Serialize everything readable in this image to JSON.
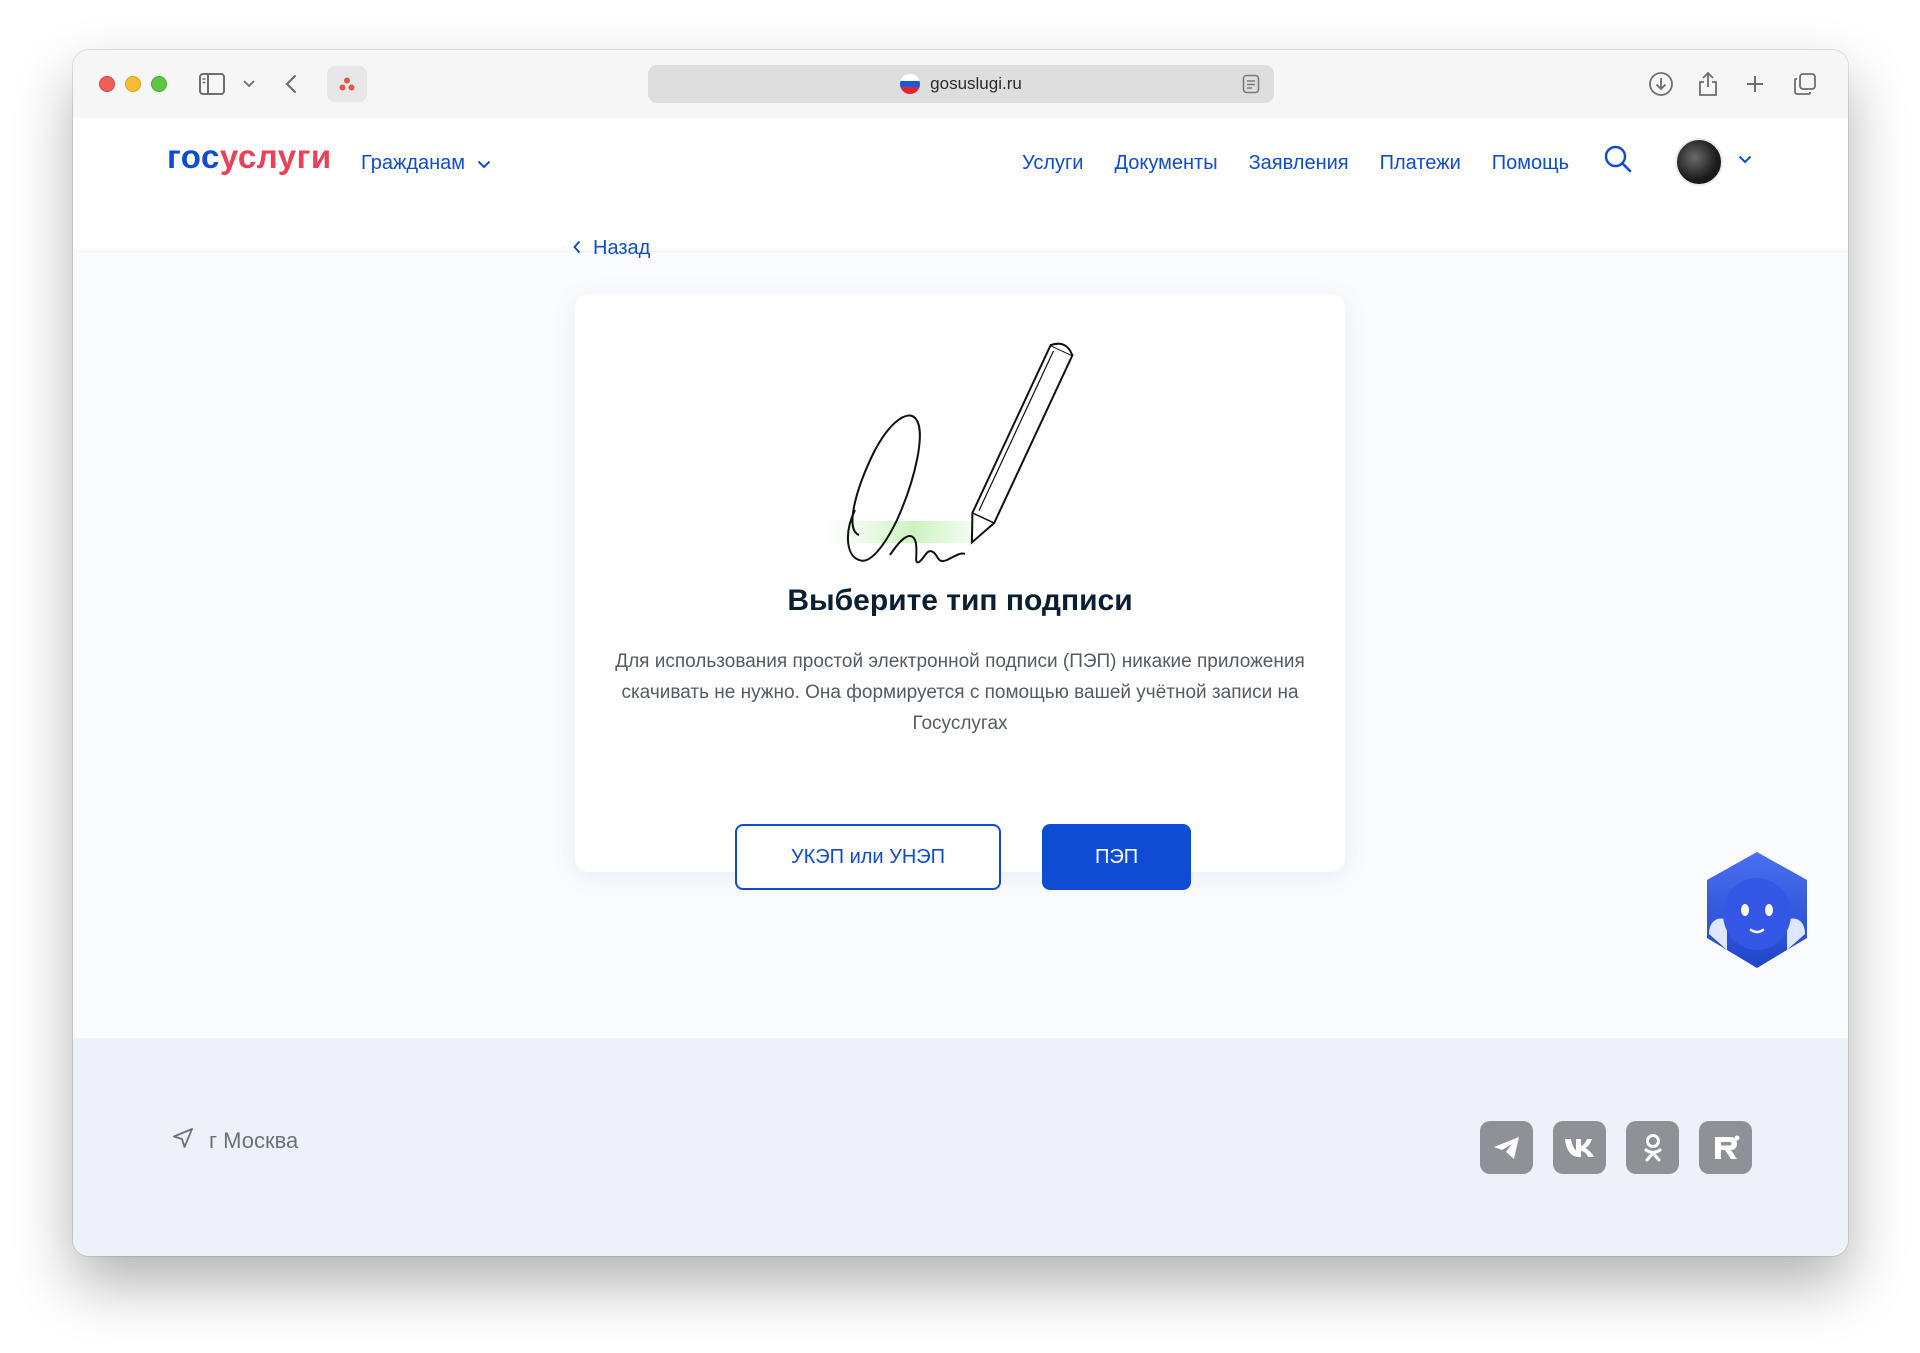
{
  "browser": {
    "url": "gosuslugi.ru",
    "flag_colors": [
      "#ffffff",
      "#1c57d6",
      "#e2252c"
    ]
  },
  "header": {
    "logo_part1": "гос",
    "logo_part2": "услуги",
    "audience_label": "Гражданам",
    "nav": [
      "Услуги",
      "Документы",
      "Заявления",
      "Платежи",
      "Помощь"
    ]
  },
  "main": {
    "back_label": "Назад",
    "title": "Выберите тип подписи",
    "description": "Для использования простой электронной подписи (ПЭП) никакие приложения скачивать не нужно. Она формируется с помощью вашей учётной записи на Госуслугах",
    "btn_secondary": "УКЭП или УНЭП",
    "btn_primary": "ПЭП"
  },
  "footer": {
    "location": "г Москва",
    "socials": [
      "telegram-icon",
      "vk-icon",
      "odnoklassniki-icon",
      "rutube-icon"
    ]
  },
  "colors": {
    "brand_blue": "#0d4cd3",
    "brand_red": "#ee3f58",
    "text_dark": "#0b1f33",
    "social_gray": "#8f9197"
  }
}
